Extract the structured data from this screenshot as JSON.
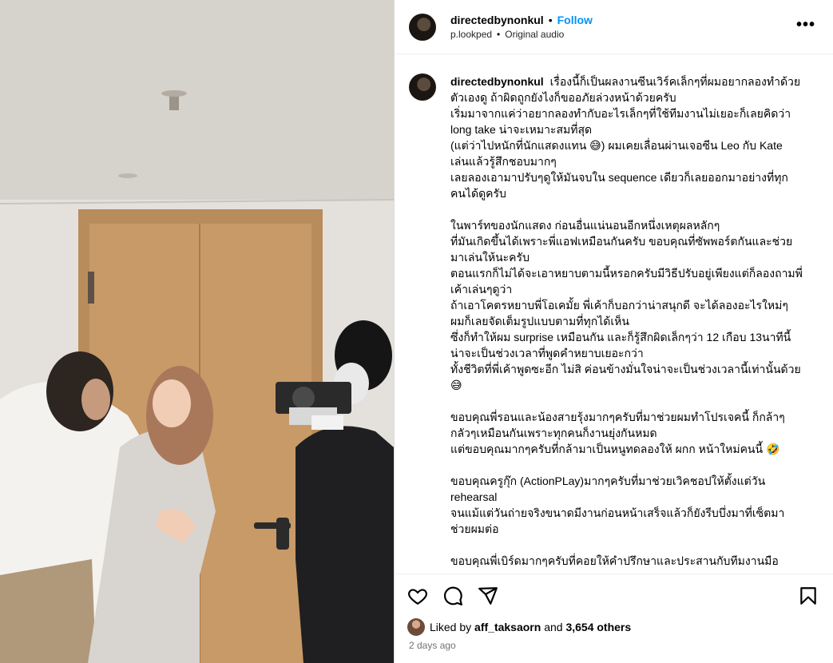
{
  "post": {
    "username": "directedbynonkul",
    "follow_label": "Follow",
    "audio_user": "p.lookped",
    "audio_label": "Original audio",
    "more_label": "•••"
  },
  "caption": {
    "username": "directedbynonkul",
    "lines": [
      "เรื่องนี้ก็เป็นผลงานซีนเวิร์คเล็กๆที่ผมอยากลองทำด้วย",
      "ตัวเองดู ถ้าผิดถูกยังไงก็ขออภัยล่วงหน้าด้วยครับ",
      "เริ่มมาจากแค่ว่าอยากลองทำกับอะไรเล็กๆที่ใช้ทีมงานไม่เยอะก็เลยคิดว่า",
      "long take น่าจะเหมาะสมที่สุด",
      "(แต่ว่าไปหนักที่นักแสดงแทน 😅) ผมเคยเลื่อนผ่านเจอซีน Leo กับ Kate",
      "เล่นแล้วรู้สึกชอบมากๆ",
      "เลยลองเอามาปรับๆดูให้มันจบใน sequence เดียวก็เลยออกมาอย่างที่ทุก",
      "คนได้ดูครับ",
      "",
      "ในพาร์ทของนักแสดง ก่อนอื่นแน่นอนอีกหนึ่งเหตุผลหลักๆ",
      "ที่มันเกิดขึ้นได้เพราะพี่แอฟเหมือนกันครับ ขอบคุณที่ซัพพอร์ตกันและช่วย",
      "มาเล่นให้นะครับ",
      "ตอนแรกก็ไม่ได้จะเอาหยาบตามนี้หรอกครับมีวิธีปรับอยู่เพียงแต่ก็ลองถามพี่",
      "เค้าเล่นๆดูว่า",
      "ถ้าเอาโคตรหยาบพี่โอเคมั้ย พี่เค้าก็บอกว่าน่าสนุกดี จะได้ลองอะไรใหม่ๆ",
      "ผมก็เลยจัดเต็มรูปแบบตามที่ทุกได้เห็น",
      "ซึ่งก็ทำให้ผม surprise เหมือนกัน และก็รู้สึกผิดเล็กๆว่า 12 เกือบ 13นาทีนี้",
      "น่าจะเป็นช่วงเวลาที่พูดคำหยาบเยอะกว่า",
      "ทั้งชีวิตที่พี่เค้าพูดซะอีก ไม่สิ ค่อนข้างมั่นใจน่าจะเป็นช่วงเวลานี้เท่านั้นด้วย",
      "😅",
      "",
      "ขอบคุณพี่รอนและน้องสายรุ้งมากๆครับที่มาช่วยผมทำโปรเจคนี้ ก็กล้าๆ",
      "กลัวๆเหมือนกันเพราะทุกคนก็งานยุ่งกันหมด",
      "แต่ขอบคุณมากๆครับที่กล้ามาเป็นหนูทดลองให้ ผกก หน้าใหม่คนนี้ 🤣",
      "",
      "ขอบคุณครูกุ๊ก (ActionPLay)มากๆครับที่มาช่วยเวิคชอปให้ตั้งแต่วัน",
      "rehearsal",
      "จนแม้แต่วันถ่ายจริงขนาดมีงานก่อนหน้าเสร็จแล้วก็ยังรีบบึ่งมาที่เซ็ตมา",
      "ช่วยผมต่อ",
      "",
      "ขอบคุณพี่เบิร์ดมากๆครับที่คอยให้คำปรึกษาและประสานกับทีมงานมือ"
    ]
  },
  "actions": {
    "like_icon": "heart-icon",
    "comment_icon": "comment-icon",
    "share_icon": "share-icon",
    "save_icon": "bookmark-icon"
  },
  "likes": {
    "prefix": "Liked by",
    "user": "aff_taksaorn",
    "middle": "and",
    "count": "3,654 others"
  },
  "timestamp": "2 days ago"
}
